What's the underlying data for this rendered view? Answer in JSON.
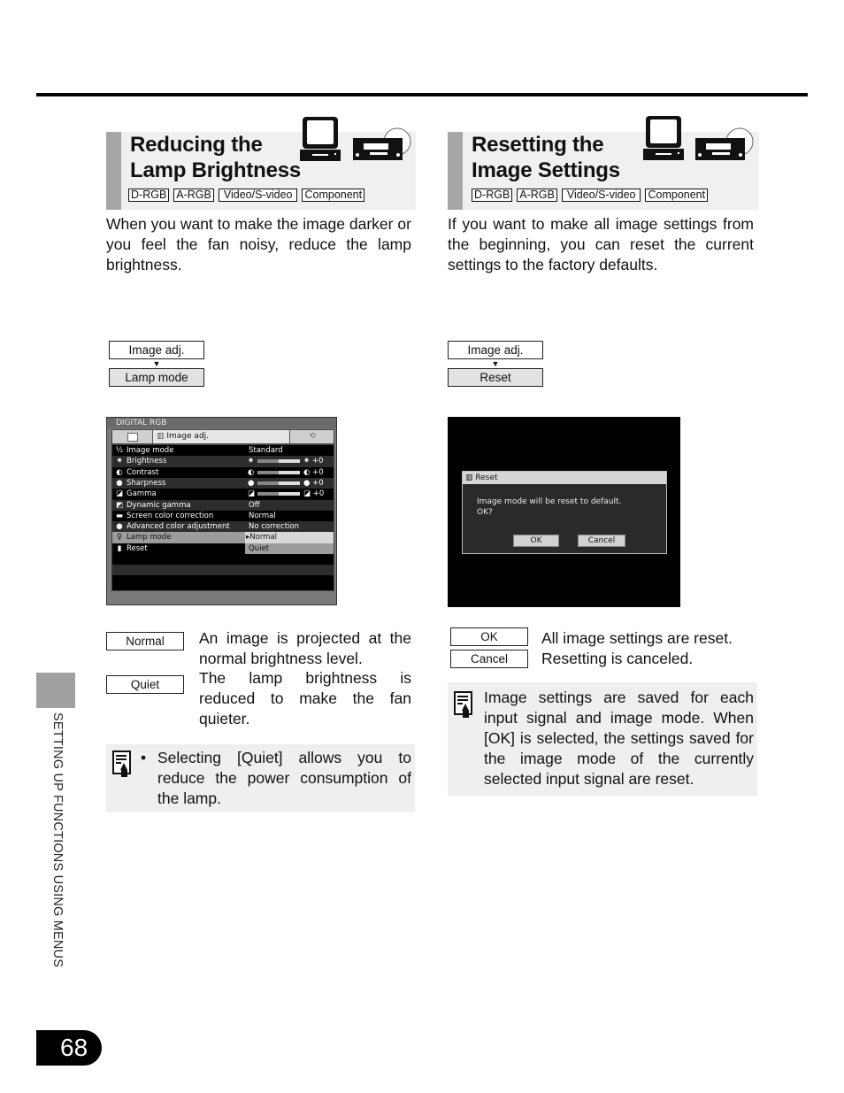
{
  "page": {
    "page_number": "68",
    "side_tab_label": "SETTING UP FUNCTIONS USING MENUS"
  },
  "left_section": {
    "title_line1": "Reducing the",
    "title_line2": "Lamp Brightness",
    "signals": [
      "D-RGB",
      "A-RGB",
      "Video/S-video",
      "Component"
    ],
    "icons": [
      "computer-icon",
      "video-player-icon"
    ],
    "intro": "When you want to make the image darker or you feel the fan noisy, reduce the lamp brightness.",
    "menu_path": [
      "Image adj.",
      "Lamp mode"
    ],
    "menu_path_arrow": "▼",
    "screenshot": {
      "header": "DIGITAL RGB",
      "tab_label": "Image adj.",
      "rows": [
        {
          "icon": "image-mode-icon",
          "glyph": "½",
          "label": "Image mode",
          "value": "Standard"
        },
        {
          "icon": "brightness-icon",
          "glyph": "✷",
          "label": "Brightness",
          "value": "+0",
          "slider": 0.5
        },
        {
          "icon": "contrast-icon",
          "glyph": "◐",
          "label": "Contrast",
          "value": "+0",
          "slider": 0.5
        },
        {
          "icon": "sharpness-icon",
          "glyph": "●",
          "label": "Sharpness",
          "value": "+0",
          "slider": 0.5
        },
        {
          "icon": "gamma-icon",
          "glyph": "◪",
          "label": "Gamma",
          "value": "+0",
          "slider": 0.5
        },
        {
          "icon": "dynamic-gamma-icon",
          "glyph": "◩",
          "label": "Dynamic gamma",
          "value": "Off"
        },
        {
          "icon": "screen-color-icon",
          "glyph": "▬",
          "label": "Screen color correction",
          "value": "Normal"
        },
        {
          "icon": "advanced-color-icon",
          "glyph": "●",
          "label": "Advanced color adjustment",
          "value": "No correction"
        },
        {
          "icon": "lamp-icon",
          "glyph": "♀",
          "label": "Lamp mode",
          "value": "Normal",
          "value_marker": "▸"
        },
        {
          "icon": "reset-icon",
          "glyph": "▮",
          "label": "Reset",
          "value": "Quiet"
        }
      ]
    },
    "options": [
      {
        "label": "Normal",
        "description": "An image is projected at the normal brightness level."
      },
      {
        "label": "Quiet",
        "description": "The lamp brightness is reduced to make the fan quieter."
      }
    ],
    "note": {
      "bullet": "•",
      "text": "Selecting [Quiet] allows you to reduce the power consumption of the lamp."
    }
  },
  "right_section": {
    "title_line1": "Resetting the",
    "title_line2": "Image Settings",
    "signals": [
      "D-RGB",
      "A-RGB",
      "Video/S-video",
      "Component"
    ],
    "icons": [
      "computer-icon",
      "video-player-icon"
    ],
    "intro": "If you want to make all image settings from the beginning, you can reset the current settings to the factory defaults.",
    "menu_path": [
      "Image adj.",
      "Reset"
    ],
    "menu_path_arrow": "▼",
    "screenshot": {
      "dialog_title": "Reset",
      "message_line1": "Image mode will be reset to default.",
      "message_line2": "OK?",
      "ok_label": "OK",
      "cancel_label": "Cancel"
    },
    "options": [
      {
        "label": "OK",
        "description": "All image settings are reset."
      },
      {
        "label": "Cancel",
        "description": "Resetting is canceled."
      }
    ],
    "note": {
      "text": "Image settings are saved for each input signal and image mode. When [OK] is selected, the settings saved for the image mode of the currently selected input signal are reset."
    }
  }
}
